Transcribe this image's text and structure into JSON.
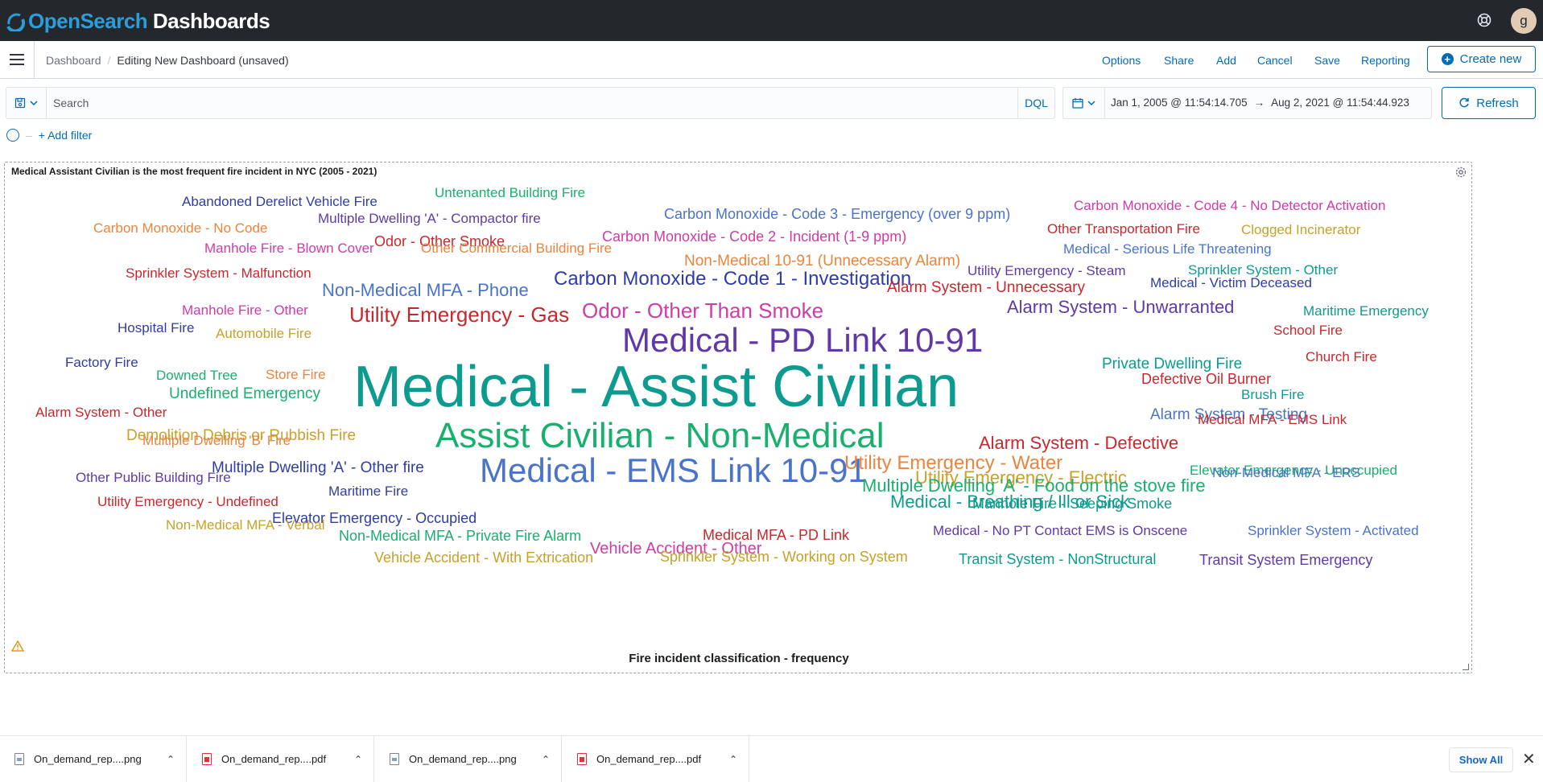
{
  "app": {
    "logo_open": "OpenSearch",
    "logo_dashboards": " Dashboards",
    "user_initial": "g"
  },
  "breadcrumb": {
    "root": "Dashboard",
    "current": "Editing New Dashboard (unsaved)"
  },
  "nav_actions": {
    "options": "Options",
    "share": "Share",
    "add": "Add",
    "cancel": "Cancel",
    "save": "Save",
    "reporting": "Reporting",
    "create_new": "Create new"
  },
  "query": {
    "placeholder": "Search",
    "value": "",
    "language": "DQL"
  },
  "time": {
    "start": "Jan 1, 2005 @ 11:54:14.705",
    "end": "Aug 2, 2021 @ 11:54:44.923",
    "refresh_label": "Refresh"
  },
  "filter": {
    "add_label": "+ Add filter"
  },
  "panel": {
    "title": "Medical Assistant Civilian is the most frequent fire incident in NYC (2005 - 2021)",
    "x_axis_title": "Fire incident classification - frequency"
  },
  "colors": {
    "accent": "#006bb8",
    "topbar": "#24272c",
    "palette": {
      "teal": "#0c9b8e",
      "purple": "#5f3aa6",
      "blue": "#4a73c9",
      "green": "#19b06e",
      "orange": "#e8853f",
      "red": "#c8282d",
      "pink": "#cf3ca6",
      "gold": "#c7a12a",
      "navy": "#2f3da4"
    }
  },
  "chart_data": {
    "type": "wordcloud",
    "words": [
      {
        "text": "Medical - Assist Civilian",
        "size": 72,
        "color": "teal"
      },
      {
        "text": "Assist Civilian - Non-Medical",
        "size": 44,
        "color": "green"
      },
      {
        "text": "Medical - EMS Link 10-91",
        "size": 42,
        "color": "blue"
      },
      {
        "text": "Medical - PD Link 10-91",
        "size": 42,
        "color": "purple"
      },
      {
        "text": "Carbon Monoxide - Code 1 - Investigation",
        "size": 24,
        "color": "navy"
      },
      {
        "text": "Odor - Other Than Smoke",
        "size": 26,
        "color": "pink"
      },
      {
        "text": "Utility Emergency - Gas",
        "size": 26,
        "color": "red"
      },
      {
        "text": "Non-Medical MFA - Phone",
        "size": 22,
        "color": "blue"
      },
      {
        "text": "Alarm System - Unwarranted",
        "size": 22,
        "color": "purple"
      },
      {
        "text": "Alarm System - Defective",
        "size": 22,
        "color": "red"
      },
      {
        "text": "Utility Emergency - Electric",
        "size": 22,
        "color": "gold"
      },
      {
        "text": "Utility Emergency - Water",
        "size": 24,
        "color": "orange"
      },
      {
        "text": "Medical - Breathing / Ill or Sick",
        "size": 22,
        "color": "teal"
      },
      {
        "text": "Multiple Dwelling 'A' - Food on the stove fire",
        "size": 22,
        "color": "green"
      },
      {
        "text": "Vehicle Accident - Other",
        "size": 20,
        "color": "pink"
      },
      {
        "text": "Non-Medical 10-91 (Unnecessary Alarm)",
        "size": 19,
        "color": "orange"
      },
      {
        "text": "Alarm System - Unnecessary",
        "size": 19,
        "color": "red"
      },
      {
        "text": "Demolition Debris or Rubbish Fire",
        "size": 19,
        "color": "gold"
      },
      {
        "text": "Undefined Emergency",
        "size": 19,
        "color": "green"
      },
      {
        "text": "Multiple Dwelling 'A' - Other fire",
        "size": 19,
        "color": "navy"
      },
      {
        "text": "Carbon Monoxide - Code 2 - Incident (1-9 ppm)",
        "size": 18,
        "color": "pink"
      },
      {
        "text": "Carbon Monoxide - Code 3 - Emergency (over 9 ppm)",
        "size": 18,
        "color": "blue"
      },
      {
        "text": "Alarm System - Testing",
        "size": 19,
        "color": "blue"
      },
      {
        "text": "Odor - Other Smoke",
        "size": 18,
        "color": "red"
      },
      {
        "text": "Elevator Emergency - Occupied",
        "size": 18,
        "color": "navy"
      },
      {
        "text": "Private Dwelling Fire",
        "size": 19,
        "color": "teal"
      },
      {
        "text": "Non-Medical MFA - Private Fire Alarm",
        "size": 18,
        "color": "green"
      },
      {
        "text": "Medical MFA - PD Link",
        "size": 18,
        "color": "red"
      },
      {
        "text": "Vehicle Accident - With Extrication",
        "size": 18,
        "color": "gold"
      },
      {
        "text": "Sprinkler System - Working on System",
        "size": 18,
        "color": "gold"
      },
      {
        "text": "Transit System - NonStructural",
        "size": 18,
        "color": "teal"
      },
      {
        "text": "Transit System Emergency",
        "size": 18,
        "color": "purple"
      },
      {
        "text": "Manhole Fire - Seeping Smoke",
        "size": 18,
        "color": "teal"
      },
      {
        "text": "Elevator Emergency - Unoccupied",
        "size": 17,
        "color": "green"
      },
      {
        "text": "Defective Oil Burner",
        "size": 18,
        "color": "red"
      },
      {
        "text": "Medical - No PT Contact EMS is Onscene",
        "size": 17,
        "color": "purple"
      },
      {
        "text": "Sprinkler System - Activated",
        "size": 17,
        "color": "blue"
      },
      {
        "text": "Medical - Victim Deceased",
        "size": 17,
        "color": "navy"
      },
      {
        "text": "Utility Emergency - Steam",
        "size": 17,
        "color": "purple"
      },
      {
        "text": "Medical - Serious Life Threatening",
        "size": 17,
        "color": "blue"
      },
      {
        "text": "Carbon Monoxide - Code 4 - No Detector Activation",
        "size": 17,
        "color": "pink"
      },
      {
        "text": "Multiple Dwelling 'A' - Compactor fire",
        "size": 17,
        "color": "purple"
      },
      {
        "text": "Abandoned Derelict Vehicle Fire",
        "size": 17,
        "color": "navy"
      },
      {
        "text": "Untenanted Building Fire",
        "size": 17,
        "color": "green"
      },
      {
        "text": "Carbon Monoxide - No Code",
        "size": 17,
        "color": "orange"
      },
      {
        "text": "Manhole Fire - Blown Cover",
        "size": 17,
        "color": "pink"
      },
      {
        "text": "Other Commercial Building Fire",
        "size": 17,
        "color": "orange"
      },
      {
        "text": "Other Transportation Fire",
        "size": 17,
        "color": "red"
      },
      {
        "text": "Clogged Incinerator",
        "size": 17,
        "color": "gold"
      },
      {
        "text": "Sprinkler System - Malfunction",
        "size": 17,
        "color": "red"
      },
      {
        "text": "Sprinkler System - Other",
        "size": 17,
        "color": "teal"
      },
      {
        "text": "Manhole Fire - Other",
        "size": 17,
        "color": "pink"
      },
      {
        "text": "Maritime Emergency",
        "size": 17,
        "color": "teal"
      },
      {
        "text": "Hospital Fire",
        "size": 17,
        "color": "navy"
      },
      {
        "text": "Automobile Fire",
        "size": 17,
        "color": "gold"
      },
      {
        "text": "School Fire",
        "size": 17,
        "color": "red"
      },
      {
        "text": "Factory Fire",
        "size": 17,
        "color": "navy"
      },
      {
        "text": "Church Fire",
        "size": 17,
        "color": "red"
      },
      {
        "text": "Downed Tree",
        "size": 17,
        "color": "green"
      },
      {
        "text": "Store Fire",
        "size": 17,
        "color": "orange"
      },
      {
        "text": "Brush Fire",
        "size": 17,
        "color": "teal"
      },
      {
        "text": "Alarm System - Other",
        "size": 17,
        "color": "red"
      },
      {
        "text": "Medical MFA - EMS Link",
        "size": 17,
        "color": "red"
      },
      {
        "text": "Multiple Dwelling 'B' Fire",
        "size": 17,
        "color": "orange"
      },
      {
        "text": "Other Public Building Fire",
        "size": 17,
        "color": "purple"
      },
      {
        "text": "Non-Medical MFA - ERS",
        "size": 17,
        "color": "blue"
      },
      {
        "text": "Maritime Fire",
        "size": 17,
        "color": "navy"
      },
      {
        "text": "Utility Emergency - Undefined",
        "size": 17,
        "color": "red"
      },
      {
        "text": "Non-Medical MFA - Verbal",
        "size": 17,
        "color": "gold"
      }
    ]
  },
  "downloads": {
    "items": [
      {
        "name": "On_demand_rep....png",
        "kind": "png"
      },
      {
        "name": "On_demand_rep....pdf",
        "kind": "pdf"
      },
      {
        "name": "On_demand_rep....png",
        "kind": "png"
      },
      {
        "name": "On_demand_rep....pdf",
        "kind": "pdf"
      }
    ],
    "show_all": "Show All"
  }
}
